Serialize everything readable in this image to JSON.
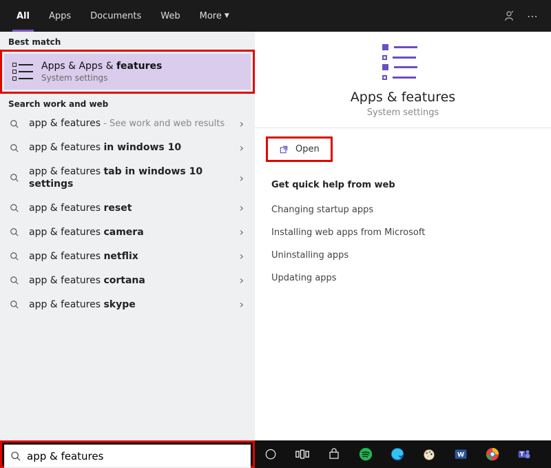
{
  "header": {
    "tabs": [
      "All",
      "Apps",
      "Documents",
      "Web",
      "More"
    ]
  },
  "left": {
    "best_match_label": "Best match",
    "best": {
      "title": "Apps & features",
      "subtitle": "System settings"
    },
    "search_web_label": "Search work and web",
    "suggestions": [
      {
        "prefix": "app & features",
        "bold": "",
        "hint": " - See work and web results"
      },
      {
        "prefix": "app & features ",
        "bold": "in windows 10",
        "hint": ""
      },
      {
        "prefix": "app & features ",
        "bold": "tab in windows 10 settings",
        "hint": ""
      },
      {
        "prefix": "app & features ",
        "bold": "reset",
        "hint": ""
      },
      {
        "prefix": "app & features ",
        "bold": "camera",
        "hint": ""
      },
      {
        "prefix": "app & features ",
        "bold": "netflix",
        "hint": ""
      },
      {
        "prefix": "app & features ",
        "bold": "cortana",
        "hint": ""
      },
      {
        "prefix": "app & features ",
        "bold": "skype",
        "hint": ""
      }
    ],
    "search_value": "app & features"
  },
  "right": {
    "title": "Apps & features",
    "subtitle": "System settings",
    "open_label": "Open",
    "help_title": "Get quick help from web",
    "help_items": [
      "Changing startup apps",
      "Installing web apps from Microsoft",
      "Uninstalling apps",
      "Updating apps"
    ]
  }
}
